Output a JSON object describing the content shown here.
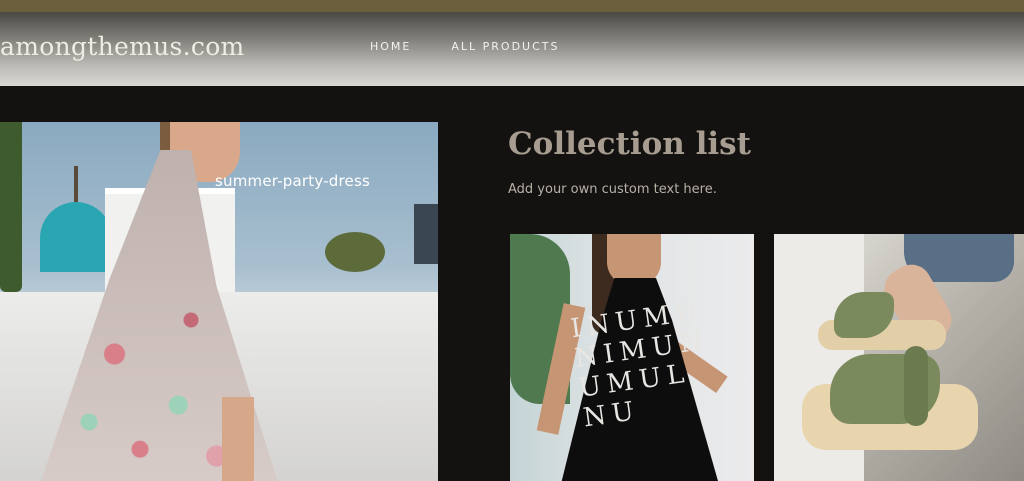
{
  "header": {
    "logo": "amongthemus.com",
    "nav": [
      "HOME",
      "ALL PRODUCTS"
    ]
  },
  "hero": {
    "caption": "summer-party-dress"
  },
  "collection": {
    "title": "Collection list",
    "subtitle": "Add your own custom text here."
  },
  "colors": {
    "topbar": "#6b5f3e",
    "background": "#141211",
    "title": "#a69d90"
  }
}
